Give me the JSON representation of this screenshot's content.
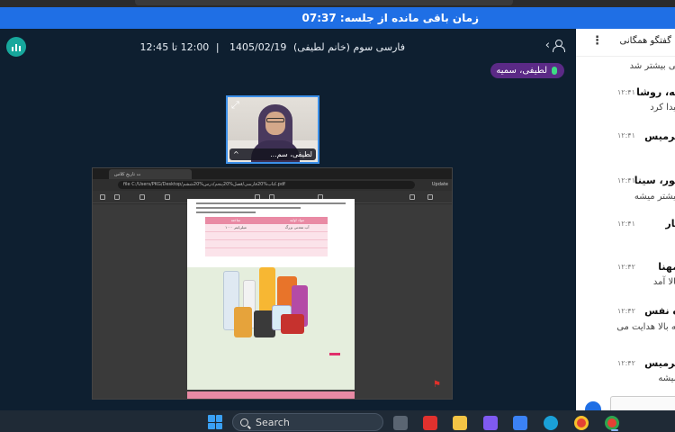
{
  "timer": {
    "label": "زمان باقی مانده از جلسه: 07:37"
  },
  "header": {
    "session_title": "فارسی سوم (خانم لطیفی)",
    "date": "1405/02/19",
    "time_range": "12:00 تا 12:45",
    "separator": "|"
  },
  "speaker": {
    "name": "لطیفی، سمیه"
  },
  "camera": {
    "name": "لطیفی، سم..."
  },
  "shared_screen": {
    "tab_label": "ت تاریخ کلاس",
    "url": "file  C:/Users/PKG/Desktop/کتاب%20فارسی/فصل%20پنجم/درس%20ششم.pdf",
    "update_label": "Update",
    "table": {
      "headers": [
        "مواد اولیه",
        "ساخته"
      ],
      "rows": [
        [
          "آب معدنی بزرگ",
          "۱۰۰۰ میلی‌لیتر"
        ],
        [
          "",
          ""
        ],
        [
          "",
          ""
        ]
      ]
    }
  },
  "chat": {
    "title": "گفتگو همگانی",
    "messages": [
      {
        "name": "",
        "time": "",
        "text": "نی بیشتر شد"
      },
      {
        "name": "یه، روشا",
        "time": "۱۲:۴۱",
        "text": "پیدا کرد"
      },
      {
        "name": "برمیس",
        "time": "۱۲:۴۱",
        "text": ""
      },
      {
        "name": "پور، سینا",
        "time": "۱۲:۴۱",
        "text": "بیشتر میشه"
      },
      {
        "name": "بار",
        "time": "۱۲:۴۱",
        "text": ""
      },
      {
        "name": "مهنا",
        "time": "۱۲:۴۲",
        "text": "بالا آمد"
      },
      {
        "name": "ه نفس",
        "time": "۱۲:۴۲",
        "text": "ته بالا هدایت می"
      },
      {
        "name": "برمیس",
        "time": "۱۲:۴۲",
        "text": "میشه"
      }
    ]
  },
  "taskbar": {
    "search_label": "Search"
  },
  "colors": {
    "accent": "#1f6fe5",
    "speaker_badge": "#5b2a86",
    "logo": "#17a79c"
  }
}
